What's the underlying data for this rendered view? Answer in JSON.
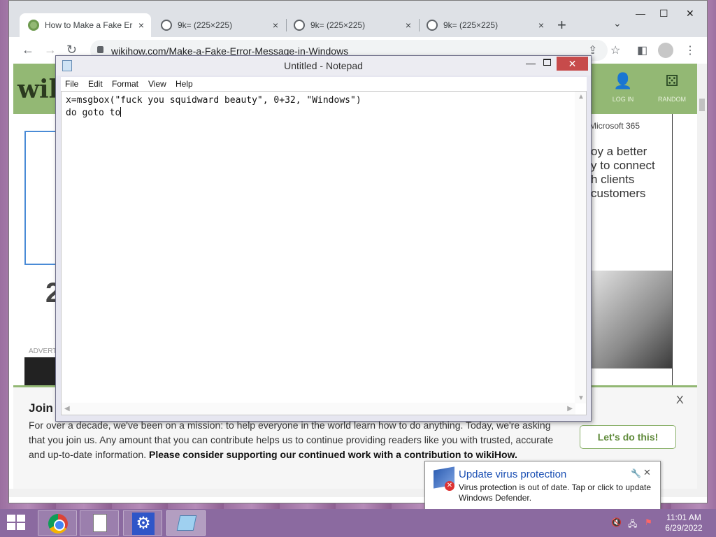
{
  "browser": {
    "tabs": [
      {
        "title": "How to Make a Fake Err",
        "close": "×",
        "favicon": "wikihow-icon"
      },
      {
        "title": "9k= (225×225)",
        "close": "×",
        "favicon": "globe-icon"
      },
      {
        "title": "9k= (225×225)",
        "close": "×",
        "favicon": "globe-icon"
      },
      {
        "title": "9k= (225×225)",
        "close": "×",
        "favicon": "globe-icon"
      }
    ],
    "new_tab": "+",
    "tab_dropdown": "⌄",
    "window_controls": {
      "minimize": "—",
      "maximize": "☐",
      "close": "✕"
    },
    "nav": {
      "back": "←",
      "forward": "→",
      "reload": "↻"
    },
    "address": "wikihow.com/Make-a-Fake-Error-Message-in-Windows",
    "toolbar_icons": {
      "share": "⇪",
      "bookmark": "☆",
      "sidepanel": "◧",
      "menu": "⋮"
    }
  },
  "wikihow": {
    "logo": "wiki",
    "login_label": "LOG IN",
    "random_label": "RANDOM",
    "login_glyph": "👤",
    "random_glyph": "⚄",
    "ad_brand": "Microsoft 365",
    "ad_lines": [
      "oy a better",
      "y to connect",
      "h clients",
      "customers"
    ],
    "big_number": "2",
    "advert_label": "ADVERT",
    "donate": {
      "heading": "Join",
      "body": "For over a decade, we've been on a mission: to help everyone in the world learn how to do anything. Today, we're asking that you join us. Any amount that you can contribute helps us to continue providing readers like you with trusted, accurate and up-to-date information. ",
      "body_bold": "Please consider supporting our continued work with a contribution to wikiHow.",
      "button": "Let's do this!",
      "close": "X"
    }
  },
  "notepad": {
    "title": "Untitled - Notepad",
    "menu": [
      "File",
      "Edit",
      "Format",
      "View",
      "Help"
    ],
    "lines": [
      "x=msgbox(\"fuck you squidward beauty\", 0+32, \"Windows\")",
      "do goto to"
    ],
    "minimize": "—",
    "close": "✕"
  },
  "notification": {
    "title": "Update virus protection",
    "body": "Virus protection is out of date. Tap or click to update Windows Defender.",
    "pin": "🔧",
    "close": "✕"
  },
  "taskbar": {
    "apps": [
      {
        "name": "Google Chrome",
        "icon": "chrome-icon"
      },
      {
        "name": "Document",
        "icon": "document-icon"
      },
      {
        "name": "Settings",
        "icon": "gear-icon"
      },
      {
        "name": "Notepad",
        "icon": "notepad-icon"
      }
    ],
    "gear_glyph": "⚙",
    "tray": {
      "volume": "🔇",
      "network": "🖧",
      "flag": "⚑"
    },
    "time": "11:01 AM",
    "date": "6/29/2022"
  }
}
